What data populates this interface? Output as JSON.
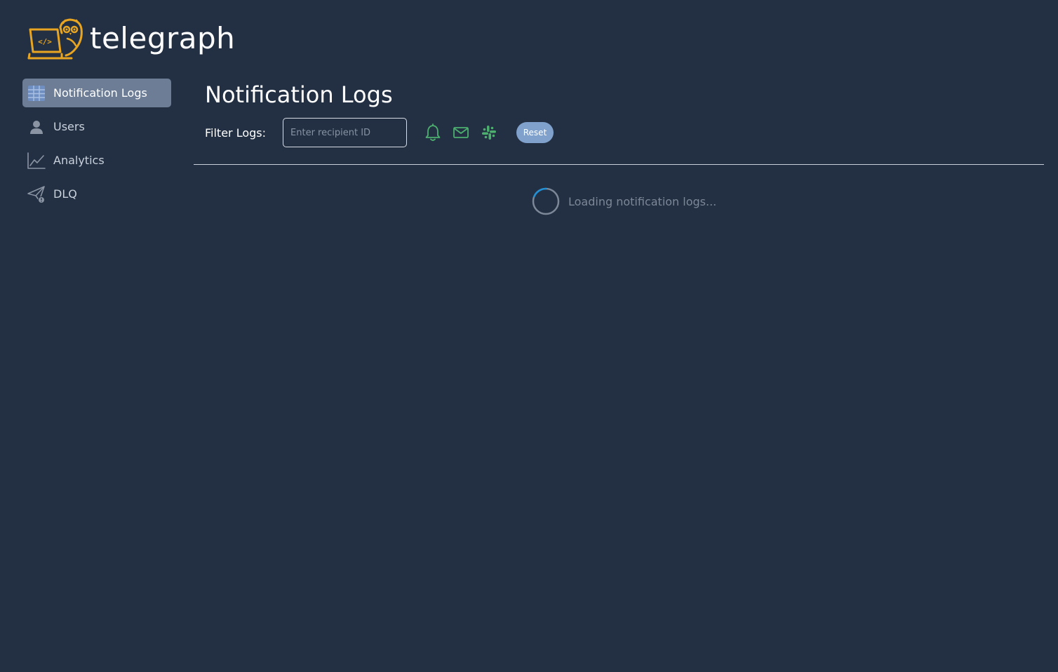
{
  "brand": {
    "name": "telegraph",
    "accent_color": "#e8a521"
  },
  "sidebar": {
    "items": [
      {
        "label": "Notification Logs",
        "icon": "table-icon",
        "active": true
      },
      {
        "label": "Users",
        "icon": "user-icon",
        "active": false
      },
      {
        "label": "Analytics",
        "icon": "line-chart-icon",
        "active": false
      },
      {
        "label": "DLQ",
        "icon": "paper-plane-alert-icon",
        "active": false
      }
    ]
  },
  "main": {
    "title": "Notification Logs",
    "filter": {
      "label": "Filter Logs:",
      "input_placeholder": "Enter recipient ID",
      "input_value": "",
      "channels": [
        {
          "name": "in-app",
          "icon": "bell-icon"
        },
        {
          "name": "email",
          "icon": "mail-icon"
        },
        {
          "name": "slack",
          "icon": "slack-icon"
        }
      ],
      "channel_color": "#4caf6e",
      "reset_label": "Reset"
    },
    "loading_text": "Loading notification logs..."
  }
}
